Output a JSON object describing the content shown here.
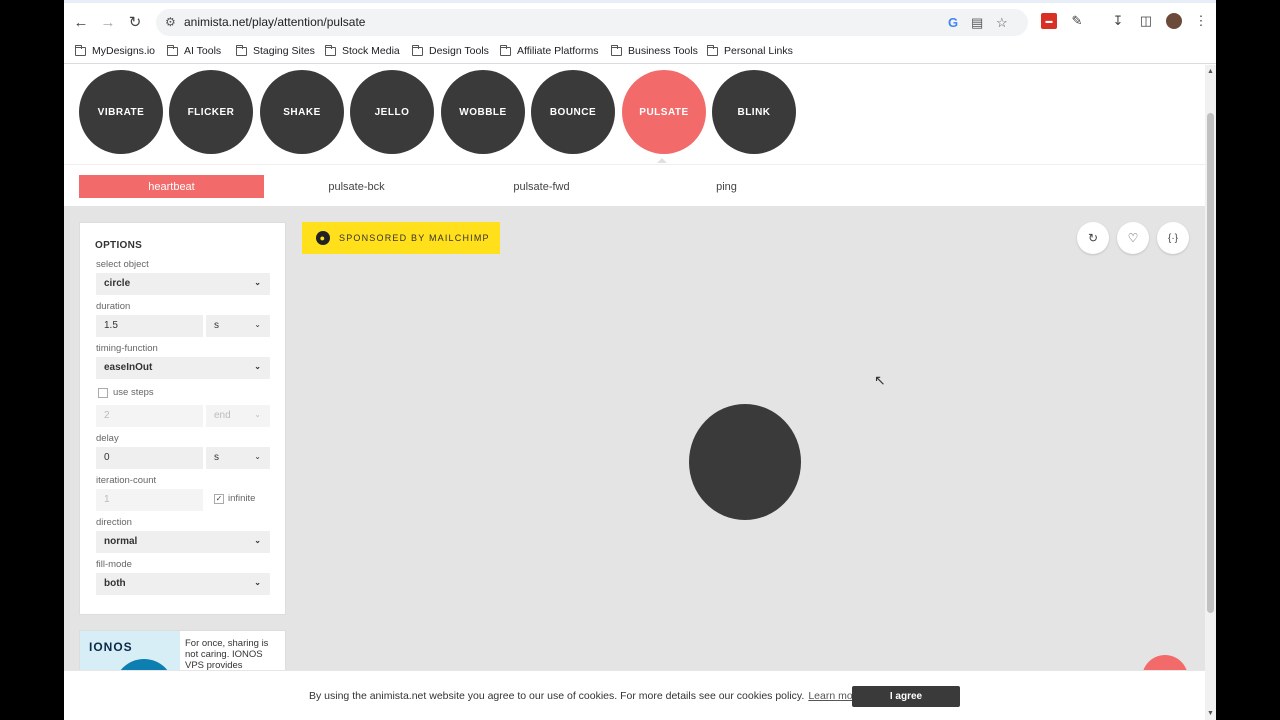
{
  "browser": {
    "url": "animista.net/play/attention/pulsate",
    "icons": [
      "back-icon",
      "forward-icon",
      "reload-icon",
      "site-info-icon",
      "google-icon",
      "install-icon",
      "star-icon",
      "extension-icon",
      "puzzle-icon",
      "download-icon",
      "sidepanel-icon",
      "profile-avatar",
      "menu-icon"
    ],
    "bookmarks": [
      "MyDesigns.io",
      "AI Tools",
      "Staging Sites",
      "Stock Media",
      "Design Tools",
      "Affiliate Platforms",
      "Business Tools",
      "Personal Links"
    ]
  },
  "categories": [
    "VIBRATE",
    "FLICKER",
    "SHAKE",
    "JELLO",
    "WOBBLE",
    "BOUNCE",
    "PULSATE",
    "BLINK"
  ],
  "active_category": "PULSATE",
  "subnav": [
    "heartbeat",
    "pulsate-bck",
    "pulsate-fwd",
    "ping"
  ],
  "active_subnav": "heartbeat",
  "options": {
    "title": "OPTIONS",
    "select_object_label": "select object",
    "select_object_value": "circle",
    "duration_label": "duration",
    "duration_value": "1.5",
    "duration_unit": "s",
    "timing_label": "timing-function",
    "timing_value": "easeInOut",
    "use_steps_label": "use steps",
    "use_steps_checked": false,
    "steps_value": "2",
    "steps_position": "end",
    "delay_label": "delay",
    "delay_value": "0",
    "delay_unit": "s",
    "iteration_label": "iteration-count",
    "iteration_value": "1",
    "infinite_label": "infinite",
    "infinite_checked": true,
    "direction_label": "direction",
    "direction_value": "normal",
    "fill_label": "fill-mode",
    "fill_value": "both"
  },
  "ad": {
    "brand": "IONOS",
    "text": "For once, sharing is not caring. IONOS VPS provides"
  },
  "sponsor": "SPONSORED BY MAILCHIMP",
  "stage_buttons": [
    "replay-icon",
    "heart-icon",
    "code-icon"
  ],
  "cookie": {
    "message": "By using the animista.net website you agree to our use of cookies. For more details see our cookies policy.",
    "learn_more": "Learn more",
    "agree": "I agree"
  },
  "colors": {
    "accent": "#f26a6a",
    "dark": "#3a3a3a",
    "sponsor": "#ffe01b"
  }
}
